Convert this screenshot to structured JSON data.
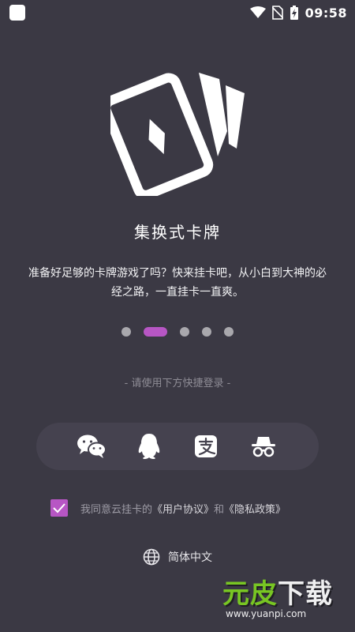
{
  "status_bar": {
    "time": "09:58"
  },
  "hero_icon": "playing-cards-icon",
  "title": "集换式卡牌",
  "description": "准备好足够的卡牌游戏了吗？快来挂卡吧，从小白到大神的必经之路，一直挂卡一直爽。",
  "pagination": {
    "total": 5,
    "active_index": 1
  },
  "login": {
    "hint": "- 请使用下方快捷登录 -",
    "options": [
      {
        "name": "wechat",
        "icon": "wechat-icon"
      },
      {
        "name": "qq",
        "icon": "qq-penguin-icon"
      },
      {
        "name": "alipay",
        "icon": "alipay-icon"
      },
      {
        "name": "incognito",
        "icon": "incognito-icon"
      }
    ]
  },
  "agreement": {
    "checked": true,
    "prefix": "我同意云挂卡的",
    "user_agreement": "《用户协议》",
    "and": "和",
    "privacy_policy": "《隐私政策》"
  },
  "language": {
    "label": "简体中文",
    "icon": "globe-icon"
  },
  "watermark": {
    "brand_a": "元皮",
    "brand_b": "下载",
    "url": "www.yuanpi.com"
  },
  "colors": {
    "background": "#3b3944",
    "accent": "#b756c4",
    "bar": "#45424f"
  }
}
